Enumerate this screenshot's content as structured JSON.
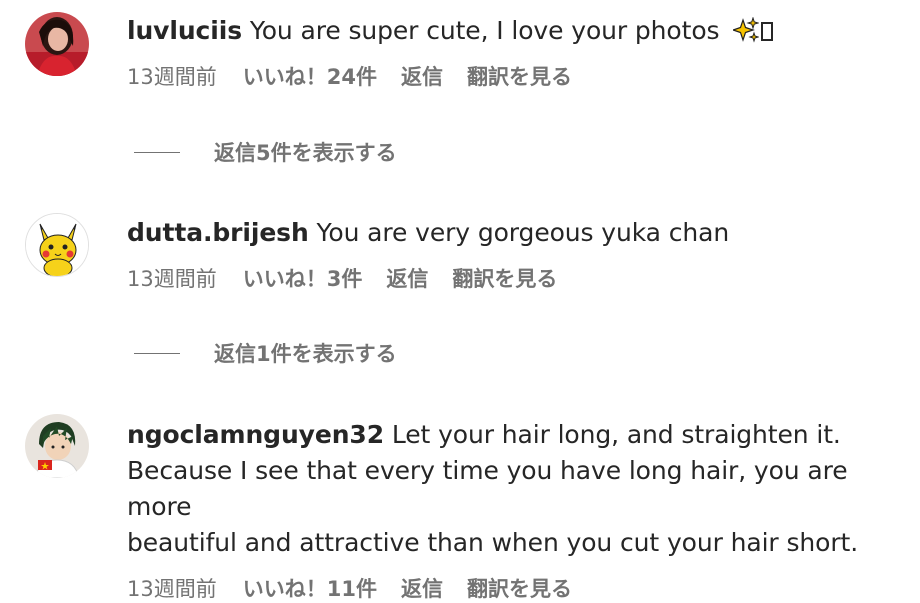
{
  "comments": [
    {
      "username": "luvluciis",
      "text": "You are super cute, I love your photos",
      "emoji": "sparkles-icon",
      "time": "13週間前",
      "likes": "いいね！24件",
      "reply": "返信",
      "translate": "翻訳を見る",
      "view_replies": "返信5件を表示する"
    },
    {
      "username": "dutta.brijesh",
      "text": "You are very gorgeous yuka chan",
      "time": "13週間前",
      "likes": "いいね！3件",
      "reply": "返信",
      "translate": "翻訳を見る",
      "view_replies": "返信1件を表示する"
    },
    {
      "username": "ngoclamnguyen32",
      "text_line1": "Let your hair long, and straighten it.",
      "text_line2": "Because I see that every time you have long hair, you are more",
      "text_line3": "beautiful and attractive than when you cut your hair short.",
      "time": "13週間前",
      "likes": "いいね！11件",
      "reply": "返信",
      "translate": "翻訳を見る"
    }
  ],
  "colors": {
    "primary_text": "#262626",
    "secondary_text": "#737373",
    "background": "#ffffff"
  }
}
